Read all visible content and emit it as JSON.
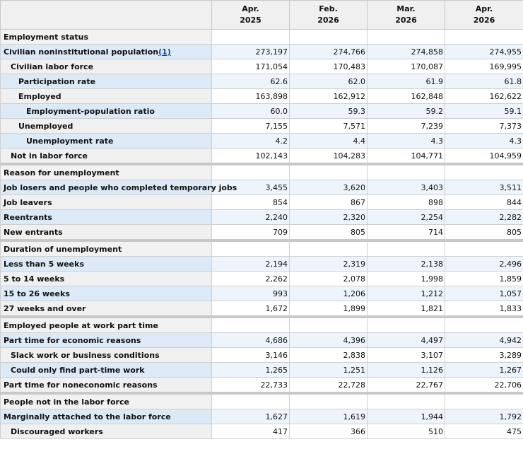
{
  "columns": [
    {
      "month": "Apr.",
      "year": "2025"
    },
    {
      "month": "Feb.",
      "year": "2026"
    },
    {
      "month": "Mar.",
      "year": "2026"
    },
    {
      "month": "Apr.",
      "year": "2026"
    }
  ],
  "sections": [
    {
      "title": "Employment status",
      "rows": [
        {
          "label": "Civilian noninstitutional population",
          "footnote": "(1)",
          "indent": 0,
          "values": [
            "273,197",
            "274,766",
            "274,858",
            "274,955"
          ]
        },
        {
          "label": "Civilian labor force",
          "indent": 1,
          "values": [
            "171,054",
            "170,483",
            "170,087",
            "169,995"
          ]
        },
        {
          "label": "Participation rate",
          "indent": 2,
          "values": [
            "62.6",
            "62.0",
            "61.9",
            "61.8"
          ]
        },
        {
          "label": "Employed",
          "indent": 2,
          "values": [
            "163,898",
            "162,912",
            "162,848",
            "162,622"
          ]
        },
        {
          "label": "Employment-population ratio",
          "indent": 3,
          "values": [
            "60.0",
            "59.3",
            "59.2",
            "59.1"
          ]
        },
        {
          "label": "Unemployed",
          "indent": 2,
          "values": [
            "7,155",
            "7,571",
            "7,239",
            "7,373"
          ]
        },
        {
          "label": "Unemployment rate",
          "indent": 3,
          "values": [
            "4.2",
            "4.4",
            "4.3",
            "4.3"
          ]
        },
        {
          "label": "Not in labor force",
          "indent": 1,
          "values": [
            "102,143",
            "104,283",
            "104,771",
            "104,959"
          ]
        }
      ]
    },
    {
      "title": "Reason for unemployment",
      "rows": [
        {
          "label": "Job losers and people who completed temporary jobs",
          "indent": 0,
          "values": [
            "3,455",
            "3,620",
            "3,403",
            "3,511"
          ]
        },
        {
          "label": "Job leavers",
          "indent": 0,
          "values": [
            "854",
            "867",
            "898",
            "844"
          ]
        },
        {
          "label": "Reentrants",
          "indent": 0,
          "values": [
            "2,240",
            "2,320",
            "2,254",
            "2,282"
          ]
        },
        {
          "label": "New entrants",
          "indent": 0,
          "values": [
            "709",
            "805",
            "714",
            "805"
          ]
        }
      ]
    },
    {
      "title": "Duration of unemployment",
      "rows": [
        {
          "label": "Less than 5 weeks",
          "indent": 0,
          "values": [
            "2,194",
            "2,319",
            "2,138",
            "2,496"
          ]
        },
        {
          "label": "5 to 14 weeks",
          "indent": 0,
          "values": [
            "2,262",
            "2,078",
            "1,998",
            "1,859"
          ]
        },
        {
          "label": "15 to 26 weeks",
          "indent": 0,
          "values": [
            "993",
            "1,206",
            "1,212",
            "1,057"
          ]
        },
        {
          "label": "27 weeks and over",
          "indent": 0,
          "values": [
            "1,672",
            "1,899",
            "1,821",
            "1,833"
          ]
        }
      ]
    },
    {
      "title": "Employed people at work part time",
      "rows": [
        {
          "label": "Part time for economic reasons",
          "indent": 0,
          "values": [
            "4,686",
            "4,396",
            "4,497",
            "4,942"
          ]
        },
        {
          "label": "Slack work or business conditions",
          "indent": 1,
          "values": [
            "3,146",
            "2,838",
            "3,107",
            "3,289"
          ]
        },
        {
          "label": "Could only find part-time work",
          "indent": 1,
          "values": [
            "1,265",
            "1,251",
            "1,126",
            "1,267"
          ]
        },
        {
          "label": "Part time for noneconomic reasons",
          "indent": 0,
          "values": [
            "22,733",
            "22,728",
            "22,767",
            "22,706"
          ]
        }
      ]
    },
    {
      "title": "People not in the labor force",
      "rows": [
        {
          "label": "Marginally attached to the labor force",
          "indent": 0,
          "values": [
            "1,627",
            "1,619",
            "1,944",
            "1,792"
          ]
        },
        {
          "label": "Discouraged workers",
          "indent": 1,
          "values": [
            "417",
            "366",
            "510",
            "475"
          ]
        }
      ]
    }
  ]
}
